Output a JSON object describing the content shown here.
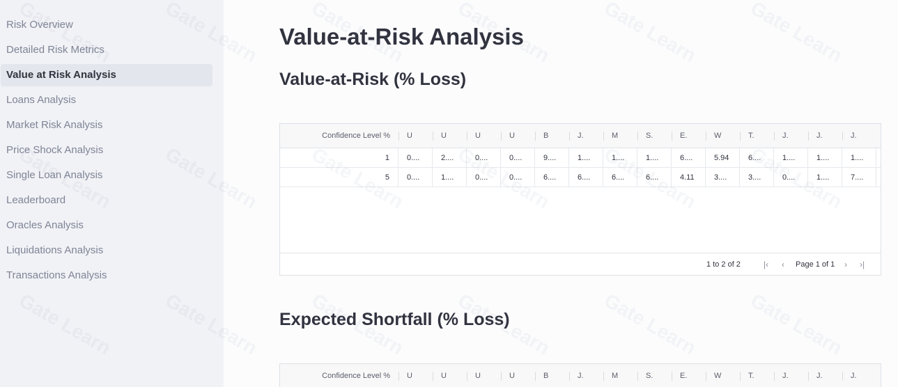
{
  "sidebar": {
    "items": [
      {
        "label": "Risk Overview"
      },
      {
        "label": "Detailed Risk Metrics"
      },
      {
        "label": "Value at Risk Analysis"
      },
      {
        "label": "Loans Analysis"
      },
      {
        "label": "Market Risk Analysis"
      },
      {
        "label": "Price Shock Analysis"
      },
      {
        "label": "Single Loan Analysis"
      },
      {
        "label": "Leaderboard"
      },
      {
        "label": "Oracles Analysis"
      },
      {
        "label": "Liquidations Analysis"
      },
      {
        "label": "Transactions Analysis"
      }
    ],
    "active_index": 2
  },
  "main": {
    "title": "Value-at-Risk Analysis",
    "var_section_title": "Value-at-Risk (% Loss)",
    "es_section_title": "Expected Shortfall (% Loss)"
  },
  "var_table": {
    "columns": [
      "Confidence Level %",
      "U",
      "U",
      "U",
      "U",
      "B",
      "J.",
      "M",
      "S.",
      "E.",
      "W",
      "T.",
      "J.",
      "J.",
      "J."
    ],
    "rows": [
      [
        "1",
        "0....",
        "2....",
        "0....",
        "0....",
        "9....",
        "1....",
        "1....",
        "1....",
        "6....",
        "5.94",
        "6....",
        "1....",
        "1....",
        "1...."
      ],
      [
        "5",
        "0....",
        "1....",
        "0....",
        "0....",
        "6....",
        "6....",
        "6....",
        "6....",
        "4.11",
        "3....",
        "3....",
        "0....",
        "1....",
        "7...."
      ]
    ],
    "pagination": {
      "summary": "1 to 2 of 2",
      "page_label": "Page 1 of 1",
      "first_icon": "first-page-icon",
      "prev_icon": "prev-page-icon",
      "next_icon": "next-page-icon",
      "last_icon": "last-page-icon"
    }
  },
  "es_table": {
    "columns": [
      "Confidence Level %",
      "U",
      "U",
      "U",
      "U",
      "B",
      "J.",
      "M",
      "S.",
      "E.",
      "W",
      "T.",
      "J.",
      "J.",
      "J."
    ]
  },
  "watermark": "Gate Learn"
}
